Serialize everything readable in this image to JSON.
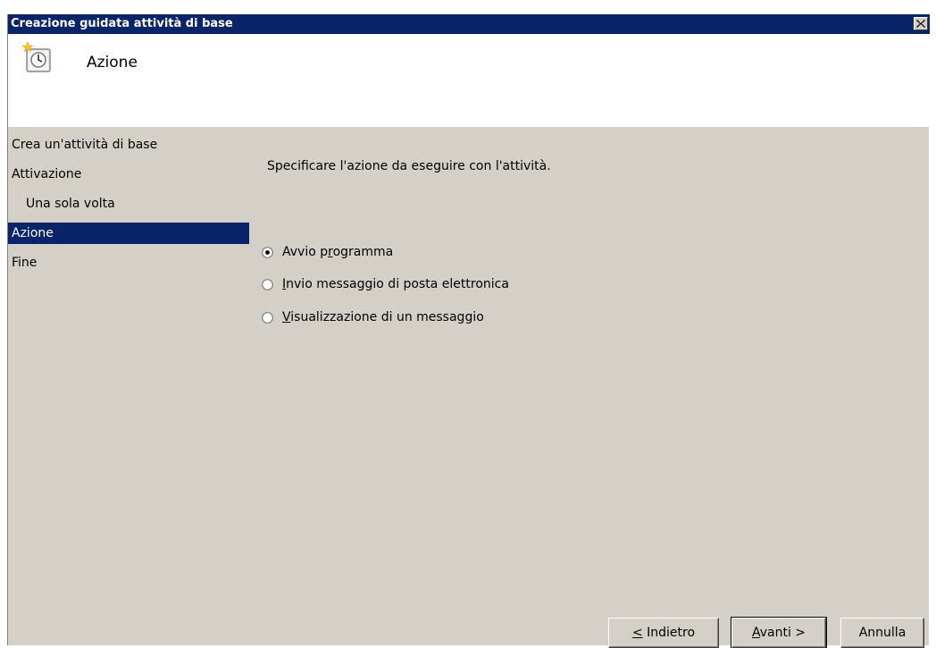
{
  "window": {
    "title": "Creazione guidata attività di base",
    "close_label": "×"
  },
  "header": {
    "title": "Azione",
    "icon": "task-clock-icon"
  },
  "nav": {
    "items": [
      {
        "label": "Crea un'attività di base",
        "indent": false,
        "selected": false
      },
      {
        "label": "Attivazione",
        "indent": false,
        "selected": false
      },
      {
        "label": "Una sola volta",
        "indent": true,
        "selected": false
      },
      {
        "label": "Azione",
        "indent": false,
        "selected": true
      },
      {
        "label": "Fine",
        "indent": false,
        "selected": false
      }
    ]
  },
  "main": {
    "prompt": "Specificare l'azione da eseguire con l'attività.",
    "options": [
      {
        "prefix": "Avvio p",
        "accel": "r",
        "suffix": "ogramma",
        "checked": true
      },
      {
        "prefix": "",
        "accel": "I",
        "suffix": "nvio messaggio di posta elettronica",
        "checked": false
      },
      {
        "prefix": "",
        "accel": "V",
        "suffix": "isualizzazione di un messaggio",
        "checked": false
      }
    ]
  },
  "buttons": {
    "back": {
      "accel": "<",
      "rest": " Indietro"
    },
    "next": {
      "accel": "A",
      "rest": "vanti >"
    },
    "cancel": {
      "label": "Annulla"
    }
  },
  "colors": {
    "titlebar": "#0a246a",
    "selection": "#0a246a",
    "face": "#d4d0c8"
  }
}
